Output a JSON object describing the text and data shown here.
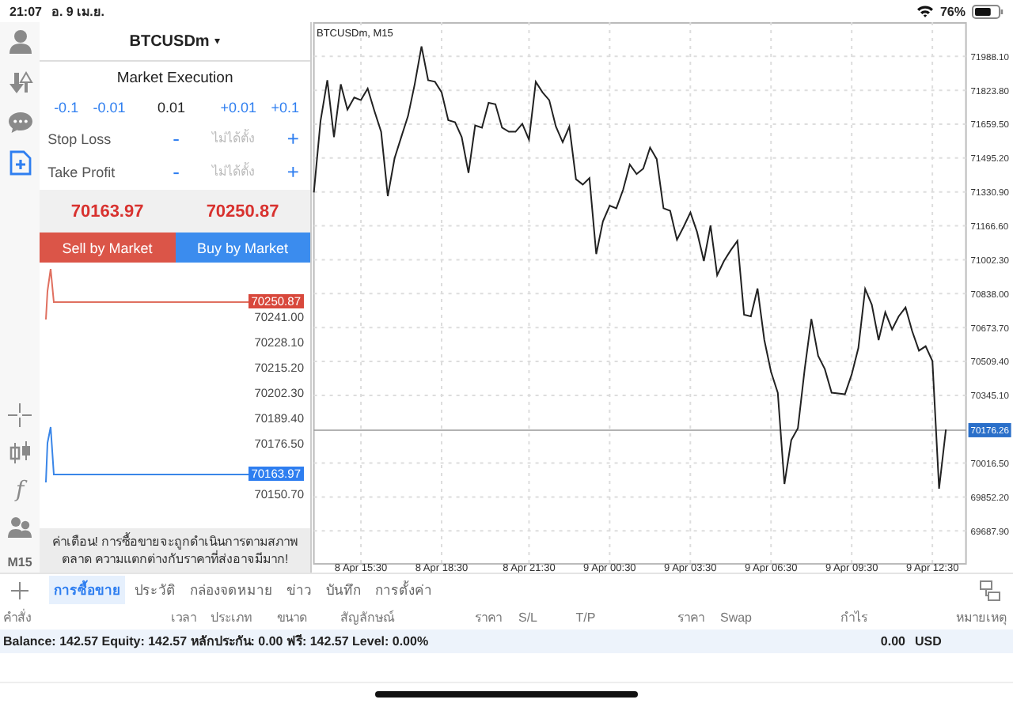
{
  "status_bar": {
    "time": "21:07",
    "date": "อ. 9 เม.ย.",
    "battery": "76%"
  },
  "rail": {
    "top_items": [
      {
        "kind": "account",
        "selected": false
      },
      {
        "kind": "trade",
        "selected": false
      },
      {
        "kind": "chat",
        "selected": false
      },
      {
        "kind": "new_order",
        "selected": true
      }
    ],
    "bottom_items": [
      {
        "kind": "crosshair"
      },
      {
        "kind": "candles"
      },
      {
        "kind": "function",
        "symbol": "f"
      },
      {
        "kind": "objects"
      }
    ],
    "timeframe": "M15"
  },
  "order": {
    "symbol": "BTCUSDm",
    "symbol_caret": "▾",
    "execution": "Market Execution",
    "volume_steps": [
      {
        "label": "-0.1",
        "kind": "step"
      },
      {
        "label": "-0.01",
        "kind": "step"
      },
      {
        "label": "0.01",
        "kind": "value"
      },
      {
        "label": "+0.01",
        "kind": "step"
      },
      {
        "label": "+0.1",
        "kind": "step"
      }
    ],
    "levels": [
      {
        "label": "Stop Loss",
        "minus": "-",
        "placeholder": "ไม่ได้ตั้ง",
        "plus": "+"
      },
      {
        "label": "Take Profit",
        "minus": "-",
        "placeholder": "ไม่ได้ตั้ง",
        "plus": "+"
      }
    ],
    "bid": "70163.**97**",
    "ask": "70250.**87**",
    "sell_button": "Sell by Market",
    "buy_button": "Buy by Market",
    "tick_chart": {
      "price_labels": [
        "70241.00",
        "70228.10",
        "70215.20",
        "70202.30",
        "70189.40",
        "70176.50",
        "70150.70"
      ],
      "ask_tag": "70250.87",
      "bid_tag": "70163.97"
    },
    "warning": "ค่าเตือน! การซื้อขายจะถูกดำเนินการตามสภาพตลาด ความแตกต่างกับราคาที่ส่งอาจมีมาก!"
  },
  "chart": {
    "chart_data": {
      "type": "line",
      "title": "BTCUSDm, M15",
      "grid": true,
      "ref_lines": [
        {
          "axis": "y",
          "value": 70176.26,
          "label": "70176.26"
        }
      ],
      "categories": [
        null,
        null,
        null,
        null,
        null,
        null,
        null,
        "8 Apr 15:30",
        null,
        null,
        null,
        null,
        null,
        null,
        null,
        null,
        null,
        null,
        null,
        "8 Apr 18:30",
        null,
        null,
        null,
        null,
        null,
        null,
        null,
        null,
        null,
        null,
        null,
        null,
        "8 Apr 21:30",
        null,
        null,
        null,
        null,
        null,
        null,
        null,
        null,
        null,
        null,
        null,
        "9 Apr 00:30",
        null,
        null,
        null,
        null,
        null,
        null,
        null,
        null,
        null,
        null,
        null,
        "9 Apr 03:30",
        null,
        null,
        null,
        null,
        null,
        null,
        null,
        null,
        null,
        null,
        null,
        "9 Apr 06:30",
        null,
        null,
        null,
        null,
        null,
        null,
        null,
        null,
        null,
        null,
        null,
        "9 Apr 09:30",
        null,
        null,
        null,
        null,
        null,
        null,
        null,
        null,
        null,
        null,
        null,
        "9 Apr 12:30",
        null,
        null
      ],
      "ylim": [
        69532,
        72154
      ],
      "yticks": [
        {
          "value": 71988.1,
          "label": "71988.10"
        },
        {
          "value": 71823.8,
          "label": "71823.80"
        },
        {
          "value": 71659.5,
          "label": "71659.50"
        },
        {
          "value": 71495.2,
          "label": "71495.20"
        },
        {
          "value": 71330.9,
          "label": "71330.90"
        },
        {
          "value": 71166.6,
          "label": "71166.60"
        },
        {
          "value": 71002.3,
          "label": "71002.30"
        },
        {
          "value": 70838,
          "label": "70838.00"
        },
        {
          "value": 70673.7,
          "label": "70673.70"
        },
        {
          "value": 70509.4,
          "label": "70509.40"
        },
        {
          "value": 70345.1,
          "label": "70345.10"
        },
        {
          "value": 70016.5,
          "label": "70016.50"
        },
        {
          "value": 69852.2,
          "label": "69852.20"
        },
        {
          "value": 69687.9,
          "label": "69687.90"
        }
      ],
      "series": [
        {
          "color": "#222222",
          "values": [
            71328,
            71674,
            71873,
            71597,
            71853,
            71730,
            71789,
            71776,
            71832,
            71725,
            71623,
            71311,
            71495,
            71597,
            71699,
            71853,
            72037,
            71873,
            71865,
            71814,
            71679,
            71669,
            71597,
            71423,
            71653,
            71643,
            71763,
            71756,
            71643,
            71623,
            71623,
            71661,
            71584,
            71865,
            71814,
            71776,
            71648,
            71572,
            71648,
            71393,
            71367,
            71398,
            71030,
            71188,
            71265,
            71252,
            71342,
            71464,
            71418,
            71444,
            71546,
            71490,
            71252,
            71239,
            71099,
            71162,
            71232,
            71137,
            70996,
            71168,
            70927,
            70996,
            71048,
            71094,
            70736,
            70728,
            70863,
            70613,
            70460,
            70358,
            69915,
            70128,
            70186,
            70473,
            70715,
            70536,
            70473,
            70358,
            70355,
            70350,
            70447,
            70575,
            70861,
            70784,
            70613,
            70748,
            70664,
            70728,
            70771,
            70656,
            70562,
            70583,
            70511,
            69892,
            70179
          ]
        }
      ]
    }
  },
  "bottom": {
    "tabs": [
      {
        "label": "การซื้อขาย",
        "selected": true
      },
      {
        "label": "ประวัติ",
        "selected": false
      },
      {
        "label": "กล่องจดหมาย",
        "selected": false
      },
      {
        "label": "ข่าว",
        "selected": false
      },
      {
        "label": "บันทึก",
        "selected": false
      },
      {
        "label": "การตั้งค่า",
        "selected": false
      }
    ],
    "columns": [
      "คำสั่ง",
      "เวลา",
      "ประเภท",
      "ขนาด",
      "สัญลักษณ์",
      "ราคา",
      "S/L",
      "T/P",
      "ราคา",
      "Swap",
      "กำไร",
      "หมายเหตุ"
    ],
    "summary": "Balance: 142.57 Equity: 142.57 หลักประกัน: 0.00 ฟรี: 142.57 Level: 0.00%",
    "profit": "0.00",
    "currency": "USD"
  }
}
